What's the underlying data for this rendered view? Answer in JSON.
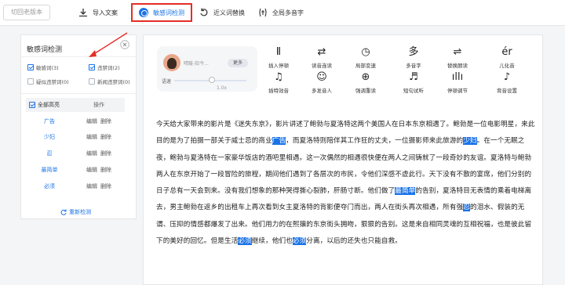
{
  "topbar": {
    "old_version": "切回老版本",
    "import": "导入文案",
    "sensitive": "敏感词检测",
    "synonym": "近义词替换",
    "polyphone": "全局多音字"
  },
  "left": {
    "title": "敏感词检测",
    "filters": [
      {
        "label": "敏感词(3)",
        "checked": true
      },
      {
        "label": "违禁词(2)",
        "checked": true
      },
      {
        "label": "疑似违禁词(0)",
        "checked": false
      },
      {
        "label": "新闻违禁词(0)",
        "checked": false
      }
    ],
    "select_all": "全部高亮",
    "action_col": "操作",
    "edit": "编辑",
    "delete": "删除",
    "words": [
      "广告",
      "少妇",
      "忍",
      "最简单",
      "必须"
    ],
    "recheck": "重新检测"
  },
  "player": {
    "name": "晴暖-知今...",
    "more": "更多",
    "speed_label": "语速",
    "speed_value": "1.0x",
    "speed_fraction": 0.5
  },
  "effects": [
    {
      "icon": "Ⅱ",
      "label": "插入停顿"
    },
    {
      "icon": "⇄",
      "label": "读音连读"
    },
    {
      "icon": "◷",
      "label": "局部变速"
    },
    {
      "icon": "多",
      "label": "多音字"
    },
    {
      "icon": "⇌",
      "label": "替换朗读"
    },
    {
      "icon": "ér",
      "label": "儿化音"
    },
    {
      "icon": "♫",
      "label": "插特效音"
    },
    {
      "icon": "☺",
      "label": "多发音人"
    },
    {
      "icon": "⊕",
      "label": "强调重读"
    },
    {
      "icon": "♬",
      "label": "短句试听"
    },
    {
      "icon": "ıllı",
      "label": "停顿调节"
    },
    {
      "icon": "♪",
      "label": "背音设置"
    }
  ],
  "article": [
    {
      "t": "今天给大家带来的影片是《迷失东京》，影片讲述了鲍勃与夏洛特这两个美国人在日本东京相遇了。鲍勃是一位电影明星，来此目的是为了拍摄一部关于威士忌的商业",
      "h": false
    },
    {
      "t": "广告",
      "h": true
    },
    {
      "t": "，而夏洛特则陪伴其工作狂的丈夫，一位摄影师来此旅游的",
      "h": false
    },
    {
      "t": "少妇",
      "h": true
    },
    {
      "t": "。在一个无眠之夜，鲍勃与夏洛特在一家豪华饭店的酒吧里相遇。这一次偶然的相遇很快便在两人之间铸就了一段奇妙的友谊。夏洛特与鲍勃两人在东京开始了一段冒险的旅程，期间他们遇到了各层次的市民，令他们深感不虚此行。天下没有不散的宴席，他们分别的日子总有一天会到来。没有我们想象的那种哭得撕心裂肺，肝肠寸断。他们做了",
      "h": false
    },
    {
      "t": "最简单",
      "h": true
    },
    {
      "t": "的告别，夏洛特目无表情的乘着电梯离去，男主鲍勃在返乡的出租车上再次看到女主夏洛特的背影便夺门而出，两人在街头再次相遇，所有强",
      "h": false
    },
    {
      "t": "忍",
      "h": true
    },
    {
      "t": "的泪水、假装的无谓、压抑的情感都爆发了出来。他们用力的在熙攘的东京街头拥吻，狠狠的告别。这是来自相同灵魂的互相祝福，也是彼此留下的美好的回忆。但是生活",
      "h": false
    },
    {
      "t": "必须",
      "h": true
    },
    {
      "t": "继续，他们也",
      "h": false
    },
    {
      "t": "必须",
      "h": true
    },
    {
      "t": "分离，以后的还失也只能自救。",
      "h": false
    }
  ]
}
